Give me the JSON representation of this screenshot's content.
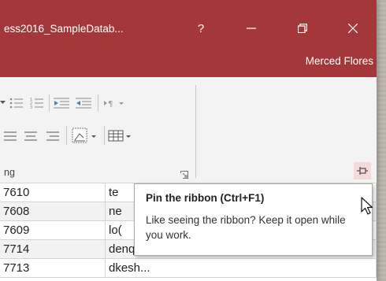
{
  "window": {
    "doc_title": "ess2016_SampleDatab...",
    "help_glyph": "?",
    "user_name": "Merced Flores",
    "accent_color": "#a4373a"
  },
  "ribbon": {
    "group_label": "ng",
    "icons": [
      "bullets-icon",
      "numbering-icon",
      "decrease-indent-icon",
      "increase-indent-icon",
      "paragraph-direction-icon",
      "align-left-icon",
      "align-center-icon",
      "align-right-icon",
      "background-color-icon",
      "gridlines-icon",
      "dialog-launcher-icon",
      "pin-ribbon-icon"
    ]
  },
  "datasheet": {
    "rows": [
      {
        "id": "7610",
        "text": "te"
      },
      {
        "id": "7608",
        "text": "ne"
      },
      {
        "id": "7609",
        "text": "lo("
      },
      {
        "id": "7714",
        "text": "denqui@email.com"
      },
      {
        "id": "7713",
        "text": "dkesh..."
      }
    ]
  },
  "tooltip": {
    "title": "Pin the ribbon (Ctrl+F1)",
    "body": "Like seeing the ribbon? Keep it open while you work."
  }
}
